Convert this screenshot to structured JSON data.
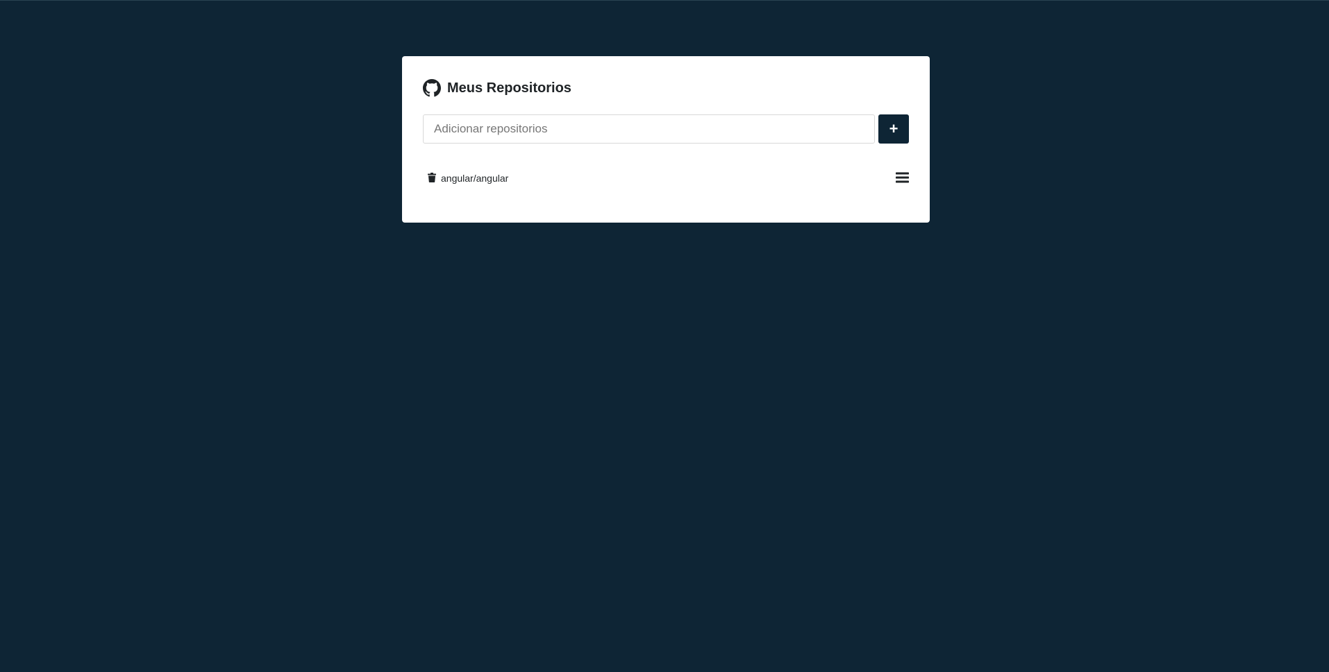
{
  "colors": {
    "background": "#0e2535",
    "card": "#ffffff",
    "accent": "#0e2535",
    "text": "#1f2326"
  },
  "header": {
    "icon": "github-icon",
    "title": "Meus Repositorios"
  },
  "form": {
    "placeholder": "Adicionar repositorios",
    "value": "",
    "add_label": "+"
  },
  "repositories": [
    {
      "name": "angular/angular",
      "delete_icon": "trash-icon",
      "details_icon": "menu-icon"
    }
  ]
}
